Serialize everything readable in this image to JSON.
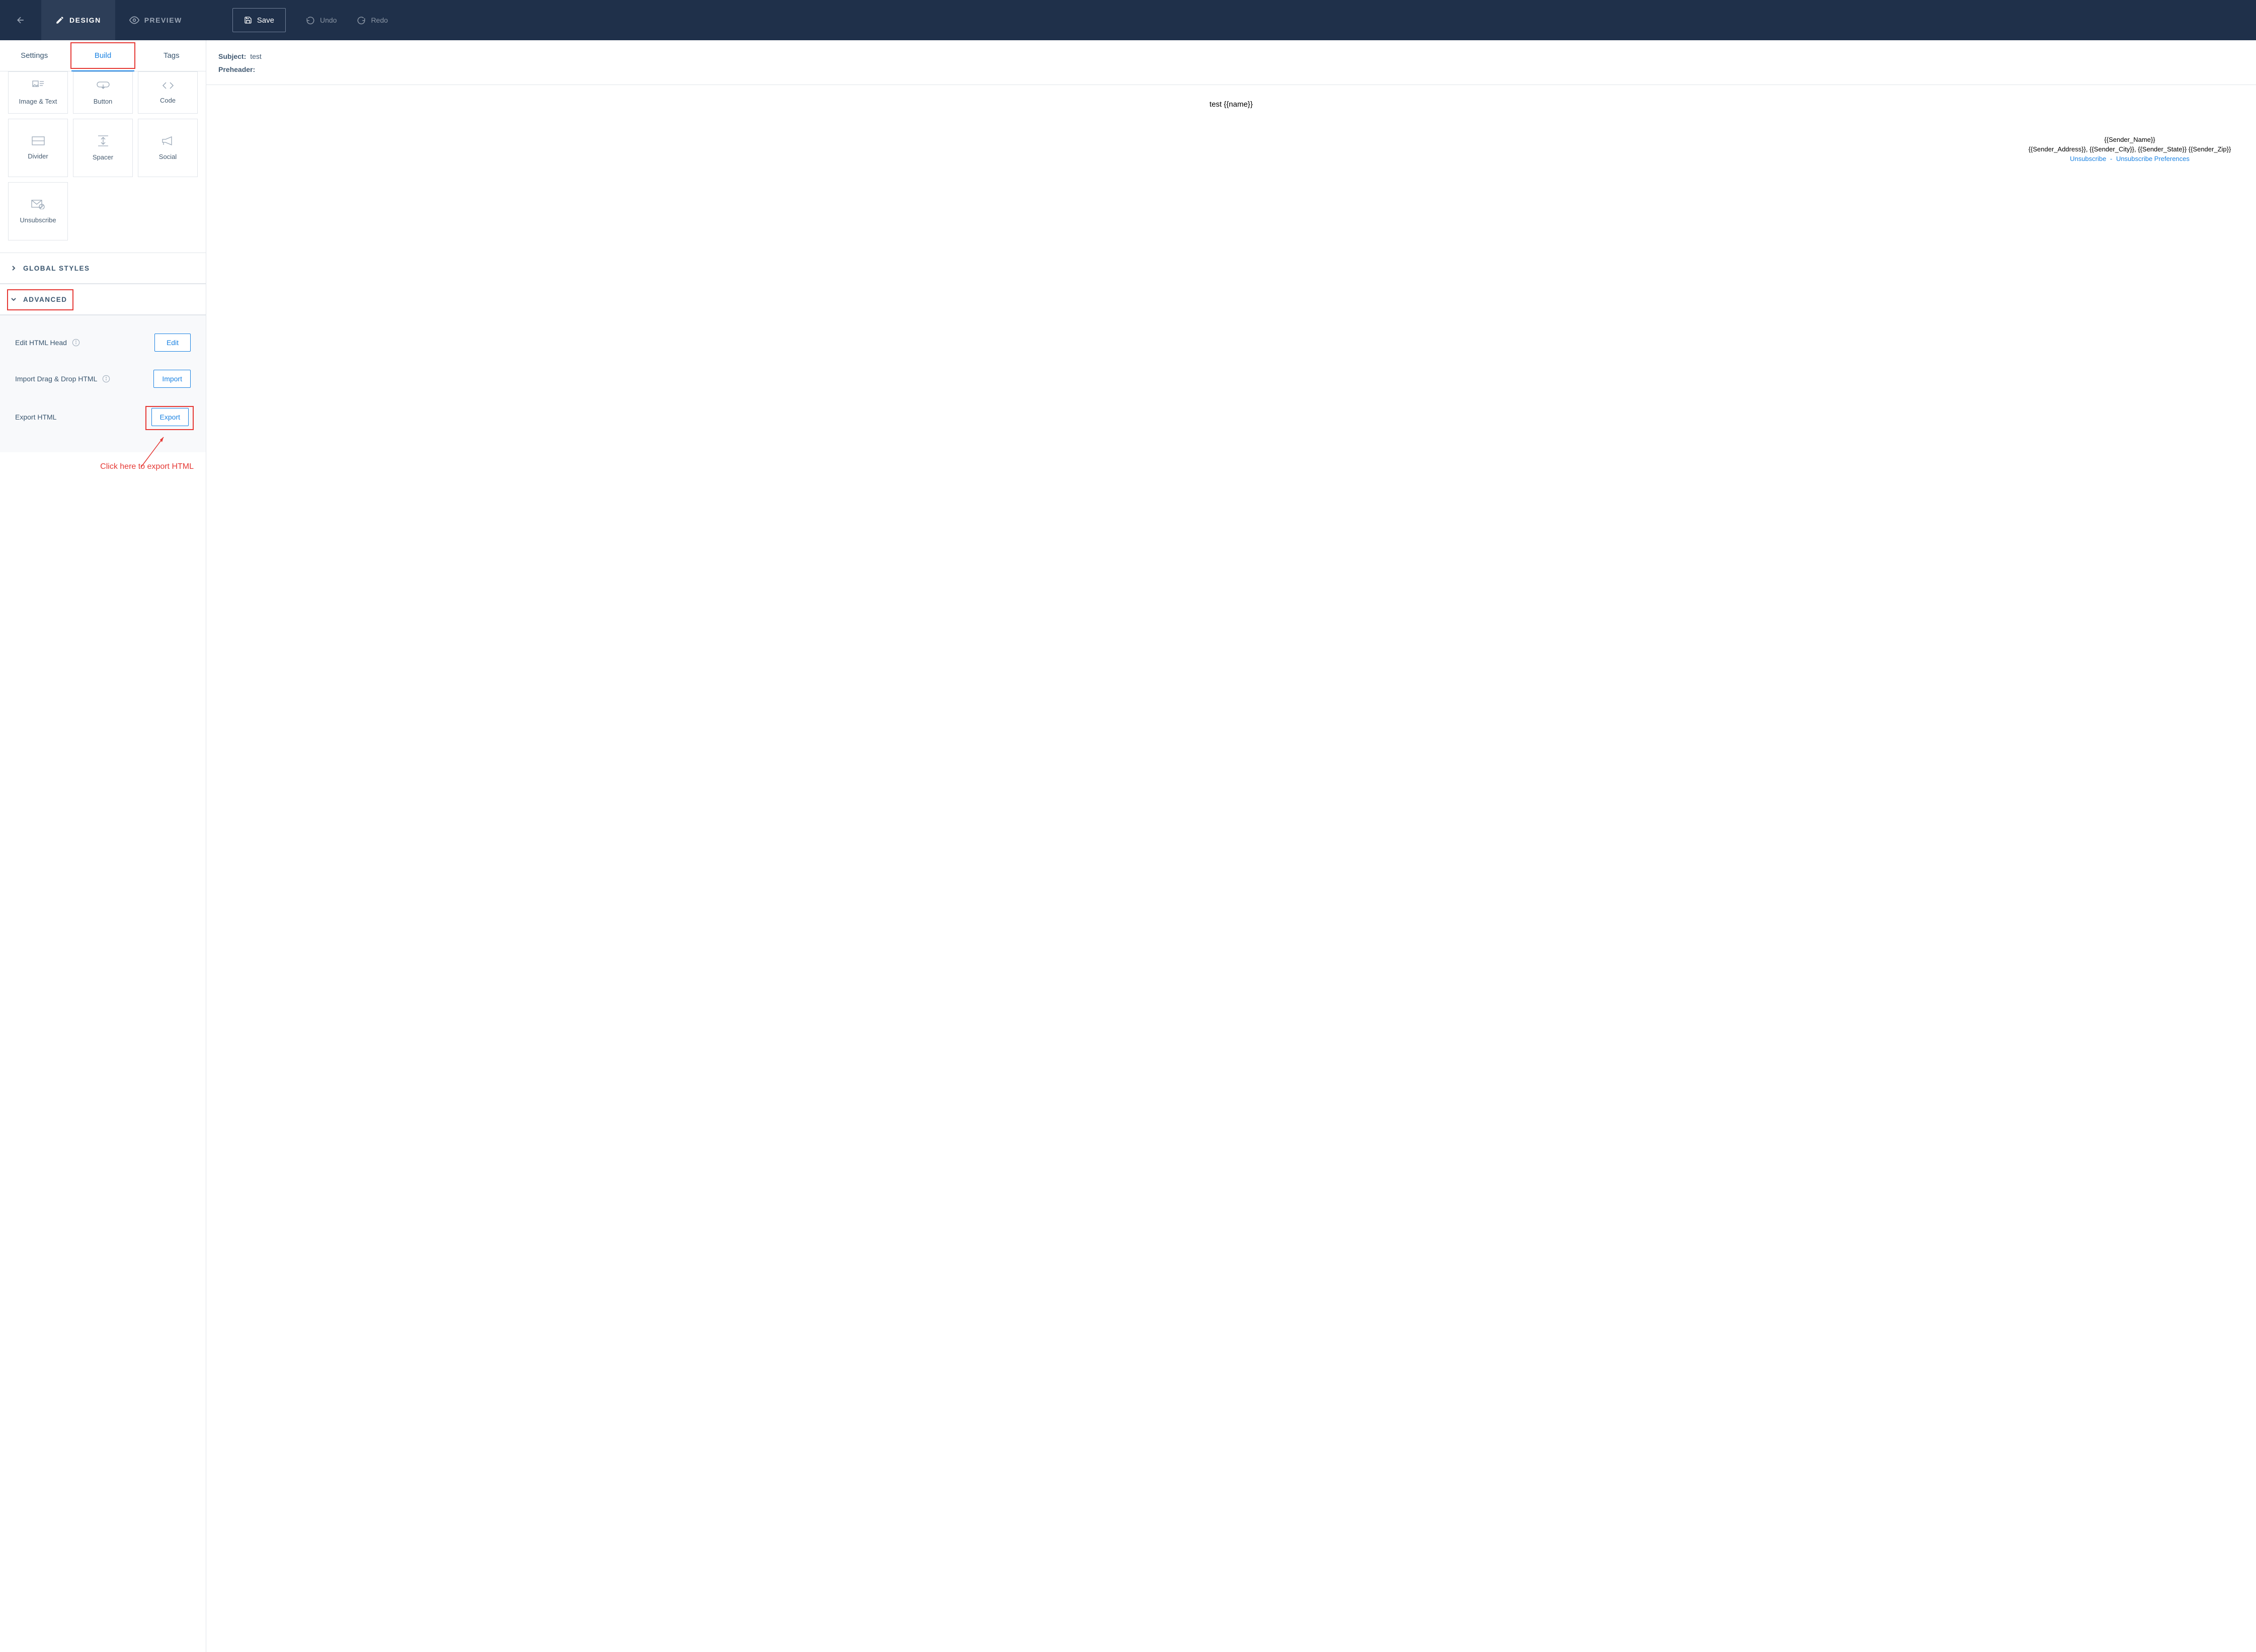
{
  "top": {
    "design": "DESIGN",
    "preview": "PREVIEW",
    "save": "Save",
    "undo": "Undo",
    "redo": "Redo"
  },
  "side_tabs": {
    "settings": "Settings",
    "build": "Build",
    "tags": "Tags"
  },
  "modules": {
    "image_text": "Image & Text",
    "button": "Button",
    "code": "Code",
    "divider": "Divider",
    "spacer": "Spacer",
    "social": "Social",
    "unsubscribe": "Unsubscribe"
  },
  "sections": {
    "global_styles": "GLOBAL STYLES",
    "advanced": "ADVANCED"
  },
  "advanced": {
    "edit_head_label": "Edit HTML Head",
    "edit_btn": "Edit",
    "import_label": "Import Drag & Drop HTML",
    "import_btn": "Import",
    "export_label": "Export HTML",
    "export_btn": "Export"
  },
  "annotation": "Click here to export HTML",
  "meta": {
    "subject_label": "Subject:",
    "subject_value": "test",
    "preheader_label": "Preheader:",
    "preheader_value": ""
  },
  "email": {
    "body": "test {{name}}",
    "sender_name": "{{Sender_Name}}",
    "address_line": "{{Sender_Address}}, {{Sender_City}}, {{Sender_State}} {{Sender_Zip}}",
    "unsubscribe": "Unsubscribe",
    "separator": "-",
    "unsubscribe_prefs": "Unsubscribe Preferences"
  }
}
